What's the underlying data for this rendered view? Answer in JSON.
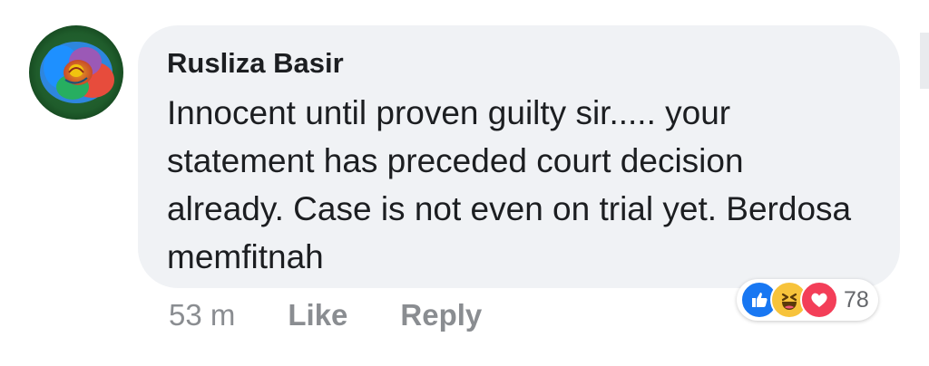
{
  "comment": {
    "author": "Rusliza Basir",
    "text": "Innocent until proven guilty sir..... your statement has preceded court decision already. Case is not even on trial yet. Berdosa memfitnah",
    "timestamp": "53 m",
    "like_label": "Like",
    "reply_label": "Reply",
    "avatar_icon": "rose-avatar",
    "reactions": {
      "icons": [
        "like-icon",
        "haha-icon",
        "love-icon"
      ],
      "count": "78"
    }
  },
  "colors": {
    "bubble_bg": "#f0f2f5",
    "text": "#1c1e21",
    "muted": "#8a8d91",
    "like_blue": "#1877f2",
    "haha_yellow": "#f7c33b",
    "love_red": "#f33e58"
  }
}
